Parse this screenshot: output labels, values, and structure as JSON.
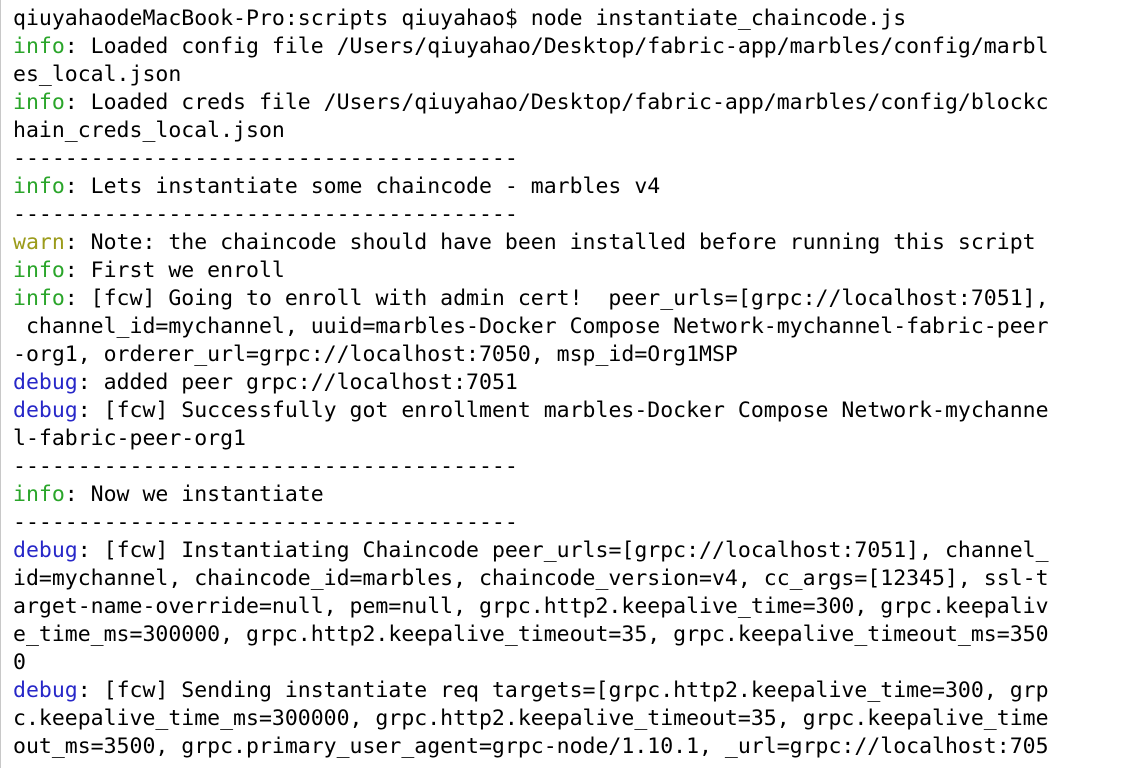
{
  "terminal": {
    "colors": {
      "info": "#2aa52a",
      "warn": "#9b9b1a",
      "debug": "#2727c8",
      "text": "#000000",
      "background": "#ffffff"
    },
    "lines": [
      {
        "level": "",
        "text": "qiuyahaodeMacBook-Pro:scripts qiuyahao$ node instantiate_chaincode.js"
      },
      {
        "level": "info",
        "text": ": Loaded config file /Users/qiuyahao/Desktop/fabric-app/marbles/config/marbl"
      },
      {
        "level": "",
        "text": "es_local.json"
      },
      {
        "level": "info",
        "text": ": Loaded creds file /Users/qiuyahao/Desktop/fabric-app/marbles/config/blockc"
      },
      {
        "level": "",
        "text": "hain_creds_local.json"
      },
      {
        "level": "",
        "text": "---------------------------------------"
      },
      {
        "level": "info",
        "text": ": Lets instantiate some chaincode - marbles v4"
      },
      {
        "level": "",
        "text": "---------------------------------------"
      },
      {
        "level": "warn",
        "text": ": Note: the chaincode should have been installed before running this script"
      },
      {
        "level": "info",
        "text": ": First we enroll"
      },
      {
        "level": "info",
        "text": ": [fcw] Going to enroll with admin cert!  peer_urls=[grpc://localhost:7051],"
      },
      {
        "level": "",
        "text": " channel_id=mychannel, uuid=marbles-Docker Compose Network-mychannel-fabric-peer"
      },
      {
        "level": "",
        "text": "-org1, orderer_url=grpc://localhost:7050, msp_id=Org1MSP"
      },
      {
        "level": "debug",
        "text": ": added peer grpc://localhost:7051"
      },
      {
        "level": "debug",
        "text": ": [fcw] Successfully got enrollment marbles-Docker Compose Network-mychanne"
      },
      {
        "level": "",
        "text": "l-fabric-peer-org1"
      },
      {
        "level": "",
        "text": "---------------------------------------"
      },
      {
        "level": "info",
        "text": ": Now we instantiate"
      },
      {
        "level": "",
        "text": "---------------------------------------"
      },
      {
        "level": "debug",
        "text": ": [fcw] Instantiating Chaincode peer_urls=[grpc://localhost:7051], channel_"
      },
      {
        "level": "",
        "text": "id=mychannel, chaincode_id=marbles, chaincode_version=v4, cc_args=[12345], ssl-t"
      },
      {
        "level": "",
        "text": "arget-name-override=null, pem=null, grpc.http2.keepalive_time=300, grpc.keepaliv"
      },
      {
        "level": "",
        "text": "e_time_ms=300000, grpc.http2.keepalive_timeout=35, grpc.keepalive_timeout_ms=350"
      },
      {
        "level": "",
        "text": "0"
      },
      {
        "level": "debug",
        "text": ": [fcw] Sending instantiate req targets=[grpc.http2.keepalive_time=300, grp"
      },
      {
        "level": "",
        "text": "c.keepalive_time_ms=300000, grpc.http2.keepalive_timeout=35, grpc.keepalive_time"
      },
      {
        "level": "",
        "text": "out_ms=3500, grpc.primary_user_agent=grpc-node/1.10.1, _url=grpc://localhost:705"
      }
    ]
  }
}
